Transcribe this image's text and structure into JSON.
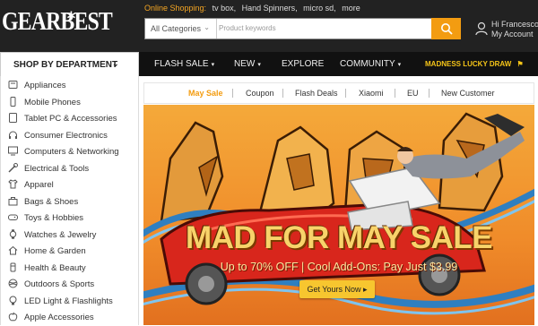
{
  "header": {
    "logo": "GEARBEST",
    "hot_label": "Online Shopping:",
    "hot_links": [
      "tv box,",
      "Hand Spinners,",
      "micro sd,",
      "more"
    ],
    "search": {
      "category": "All Categories",
      "placeholder": "Product keywords"
    },
    "user": {
      "greeting": "Hi Francesco",
      "account": "My Account"
    }
  },
  "nav": {
    "department": "SHOP BY DEPARTMENT",
    "items": [
      "FLASH SALE",
      "NEW",
      "EXPLORE",
      "COMMUNITY"
    ],
    "promo": "MADNESS LUCKY DRAW"
  },
  "sidebar": {
    "items": [
      {
        "label": "Appliances",
        "icon": "appliance-icon"
      },
      {
        "label": "Mobile Phones",
        "icon": "phone-icon"
      },
      {
        "label": "Tablet PC & Accessories",
        "icon": "tablet-icon"
      },
      {
        "label": "Consumer Electronics",
        "icon": "headphones-icon"
      },
      {
        "label": "Computers & Networking",
        "icon": "computer-icon"
      },
      {
        "label": "Electrical & Tools",
        "icon": "tools-icon"
      },
      {
        "label": "Apparel",
        "icon": "shirt-icon"
      },
      {
        "label": "Bags & Shoes",
        "icon": "bag-icon"
      },
      {
        "label": "Toys & Hobbies",
        "icon": "gamepad-icon"
      },
      {
        "label": "Watches & Jewelry",
        "icon": "watch-icon"
      },
      {
        "label": "Home & Garden",
        "icon": "home-icon"
      },
      {
        "label": "Health & Beauty",
        "icon": "health-icon"
      },
      {
        "label": "Outdoors & Sports",
        "icon": "sports-icon"
      },
      {
        "label": "LED Light & Flashlights",
        "icon": "bulb-icon"
      },
      {
        "label": "Apple Accessories",
        "icon": "apple-icon"
      }
    ]
  },
  "tabs": {
    "items": [
      "May Sale",
      "Coupon",
      "Flash Deals",
      "Xiaomi",
      "EU",
      "New Customer"
    ],
    "active": "May Sale"
  },
  "banner": {
    "title": "MAD FOR MAY SALE",
    "subtitle": "Up to 70% OFF | Cool Add-Ons: Pay Just $3.99",
    "cta": "Get Yours Now",
    "cta_arrow": "▸"
  },
  "colors": {
    "accent": "#f39c11",
    "header_bg": "#222222",
    "nav_bg": "#111111",
    "promo": "#f5c518"
  }
}
